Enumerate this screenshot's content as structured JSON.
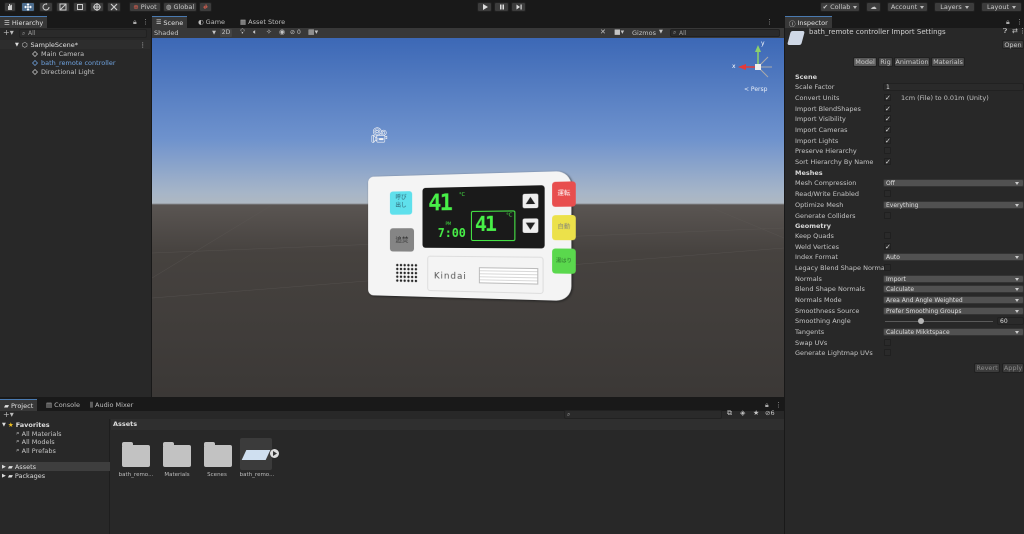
{
  "toolbar": {
    "pivot": "Pivot",
    "global": "Global",
    "collab": "Collab",
    "account": "Account",
    "layers": "Layers",
    "layout": "Layout"
  },
  "hierarchy": {
    "tab": "Hierarchy",
    "search_placeholder": "All",
    "scene": "SampleScene*",
    "items": [
      "Main Camera",
      "bath_remote controller",
      "Directional Light"
    ]
  },
  "scene_view": {
    "tabs": [
      "Scene",
      "Game",
      "Asset Store"
    ],
    "shading": "Shaded",
    "mode_2d": "2D",
    "hidden_count": "0",
    "gizmos": "Gizmos",
    "search_placeholder": "All",
    "persp": "< Persp",
    "axis_y": "y",
    "axis_x": "x"
  },
  "remote": {
    "btn_call": "呼び\n出し",
    "btn_reheat": "追焚",
    "btn_run": "運転",
    "btn_auto": "自動",
    "btn_fill": "湯はり",
    "temp_main": "41",
    "unit": "°C",
    "pm": "PM",
    "time": "7:00",
    "temp_bath": "41",
    "brand": "Kindai"
  },
  "inspector": {
    "tab": "Inspector",
    "title": "bath_remote controller Import Settings",
    "open": "Open",
    "tabs": [
      "Model",
      "Rig",
      "Animation",
      "Materials"
    ],
    "section_scene": "Scene",
    "section_meshes": "Meshes",
    "section_geometry": "Geometry",
    "scale_factor_label": "Scale Factor",
    "scale_factor_value": "1",
    "convert_units_label": "Convert Units",
    "convert_units_note": "1cm (File) to 0.01m (Unity)",
    "import_blendshapes": "Import BlendShapes",
    "import_visibility": "Import Visibility",
    "import_cameras": "Import Cameras",
    "import_lights": "Import Lights",
    "preserve_hierarchy": "Preserve Hierarchy",
    "sort_hierarchy": "Sort Hierarchy By Name",
    "mesh_compression_label": "Mesh Compression",
    "mesh_compression_value": "Off",
    "read_write": "Read/Write Enabled",
    "optimize_mesh_label": "Optimize Mesh",
    "optimize_mesh_value": "Everything",
    "generate_colliders": "Generate Colliders",
    "keep_quads": "Keep Quads",
    "weld_vertices": "Weld Vertices",
    "index_format_label": "Index Format",
    "index_format_value": "Auto",
    "legacy_blend": "Legacy Blend Shape Normals",
    "normals_label": "Normals",
    "normals_value": "Import",
    "blend_shape_normals_label": "Blend Shape Normals",
    "blend_shape_normals_value": "Calculate",
    "normals_mode_label": "Normals Mode",
    "normals_mode_value": "Area And Angle Weighted",
    "smoothness_source_label": "Smoothness Source",
    "smoothness_source_value": "Prefer Smoothing Groups",
    "smoothing_angle_label": "Smoothing Angle",
    "smoothing_angle_value": "60",
    "smoothing_angle_fraction": 0.333,
    "tangents_label": "Tangents",
    "tangents_value": "Calculate Mikktspace",
    "swap_uvs": "Swap UVs",
    "generate_lightmap_uvs": "Generate Lightmap UVs",
    "revert": "Revert",
    "apply": "Apply"
  },
  "project": {
    "tabs": [
      "Project",
      "Console",
      "Audio Mixer"
    ],
    "favorites": "Favorites",
    "fav_items": [
      "All Materials",
      "All Models",
      "All Prefabs"
    ],
    "assets": "Assets",
    "packages": "Packages",
    "breadcrumb": "Assets",
    "hidden_count": "6",
    "items": [
      "bath_remo...",
      "Materials",
      "Scenes",
      "bath_remo..."
    ]
  }
}
